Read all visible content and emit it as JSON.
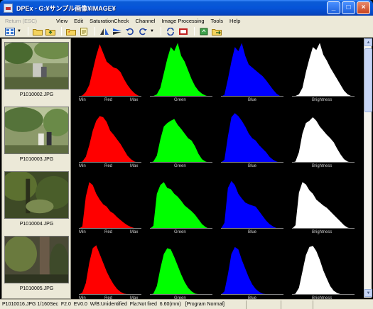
{
  "window": {
    "title": "DPEx - G:¥サンプル画像¥IMAGE¥",
    "controls": [
      "_",
      "□",
      "×"
    ]
  },
  "menu": {
    "items": [
      {
        "label": "Return (ESC)",
        "enabled": false
      },
      {
        "label": "View",
        "enabled": true
      },
      {
        "label": "Edit",
        "enabled": true
      },
      {
        "label": "SaturationCheck",
        "enabled": true
      },
      {
        "label": "Channel",
        "enabled": true
      },
      {
        "label": "Image Processing",
        "enabled": true
      },
      {
        "label": "Tools",
        "enabled": true
      },
      {
        "label": "Help",
        "enabled": true
      }
    ]
  },
  "toolbar": {
    "buttons": [
      "view-mode",
      "open-folder",
      "folder-up",
      "new-folder",
      "open-file",
      "flip",
      "rotate-flip",
      "rotate-left",
      "rotate-right",
      "refresh",
      "film",
      "recycle",
      "export"
    ]
  },
  "thumbnails": [
    {
      "filename": "P1010002.JPG"
    },
    {
      "filename": "P1010003.JPG"
    },
    {
      "filename": "P1010004.JPG"
    },
    {
      "filename": "P1010005.JPG"
    }
  ],
  "histogram_labels": {
    "red": {
      "min": "Min",
      "name": "Red",
      "max": "Max"
    },
    "green": {
      "name": "Green"
    },
    "blue": {
      "name": "Blue"
    },
    "brightness": {
      "name": "Brightness"
    }
  },
  "colors": {
    "red": "#ff0000",
    "green": "#00ff00",
    "blue": "#0000ff",
    "brightness": "#ffffff"
  },
  "status": {
    "filename": "P1010016.JPG",
    "details": " 1/160Sec  F2.0  EV0.0  W/B:Unidentified  Fla:Not fired  6.60(mm)",
    "mode": "[Program Normal]"
  },
  "chart_data": {
    "type": "area",
    "note": "",
    "rows": [
      {
        "image": "P1010002.JPG",
        "red": [
          0,
          2,
          8,
          20,
          45,
          70,
          90,
          75,
          60,
          55,
          50,
          48,
          42,
          30,
          20,
          12,
          6,
          2,
          0
        ],
        "green": [
          0,
          1,
          4,
          15,
          40,
          65,
          85,
          78,
          92,
          70,
          60,
          45,
          30,
          18,
          10,
          5,
          2,
          0,
          0
        ],
        "blue": [
          0,
          3,
          30,
          60,
          85,
          78,
          92,
          70,
          55,
          50,
          45,
          40,
          35,
          28,
          20,
          12,
          5,
          1,
          0
        ],
        "brightness": [
          0,
          1,
          4,
          15,
          42,
          65,
          85,
          80,
          92,
          72,
          62,
          50,
          40,
          30,
          20,
          10,
          4,
          1,
          0
        ]
      },
      {
        "image": "P1010003.JPG",
        "red": [
          0,
          2,
          10,
          30,
          55,
          72,
          80,
          78,
          70,
          55,
          48,
          40,
          32,
          22,
          12,
          6,
          2,
          0,
          0
        ],
        "green": [
          0,
          2,
          12,
          40,
          62,
          68,
          72,
          75,
          65,
          58,
          50,
          42,
          38,
          28,
          15,
          6,
          2,
          0,
          0
        ],
        "blue": [
          0,
          5,
          45,
          78,
          85,
          80,
          72,
          62,
          50,
          42,
          38,
          30,
          24,
          18,
          10,
          5,
          2,
          0,
          0
        ],
        "brightness": [
          0,
          2,
          18,
          50,
          68,
          72,
          78,
          72,
          62,
          55,
          48,
          42,
          35,
          24,
          14,
          6,
          2,
          0,
          0
        ]
      },
      {
        "image": "P1010004.JPG",
        "red": [
          0,
          4,
          55,
          80,
          75,
          60,
          50,
          42,
          38,
          30,
          26,
          20,
          15,
          10,
          6,
          3,
          1,
          0,
          0
        ],
        "green": [
          0,
          5,
          60,
          75,
          80,
          70,
          68,
          60,
          55,
          48,
          40,
          35,
          30,
          24,
          16,
          8,
          3,
          0,
          0
        ],
        "blue": [
          0,
          10,
          70,
          82,
          75,
          60,
          52,
          45,
          42,
          40,
          38,
          30,
          22,
          14,
          8,
          4,
          1,
          0,
          0
        ],
        "brightness": [
          0,
          6,
          62,
          80,
          76,
          66,
          60,
          50,
          45,
          40,
          36,
          30,
          24,
          18,
          12,
          6,
          2,
          0,
          0
        ]
      },
      {
        "image": "P1010005.JPG",
        "red": [
          0,
          4,
          20,
          55,
          80,
          85,
          70,
          55,
          40,
          28,
          18,
          10,
          5,
          2,
          1,
          0,
          0,
          0,
          0
        ],
        "green": [
          0,
          2,
          15,
          45,
          70,
          80,
          78,
          65,
          50,
          35,
          22,
          12,
          6,
          2,
          1,
          0,
          0,
          0,
          0
        ],
        "blue": [
          0,
          6,
          35,
          70,
          82,
          78,
          60,
          45,
          30,
          18,
          10,
          5,
          2,
          1,
          0,
          0,
          0,
          0,
          0
        ],
        "brightness": [
          0,
          2,
          12,
          40,
          68,
          82,
          84,
          75,
          60,
          42,
          28,
          15,
          7,
          3,
          1,
          0,
          0,
          0,
          0
        ]
      }
    ]
  }
}
